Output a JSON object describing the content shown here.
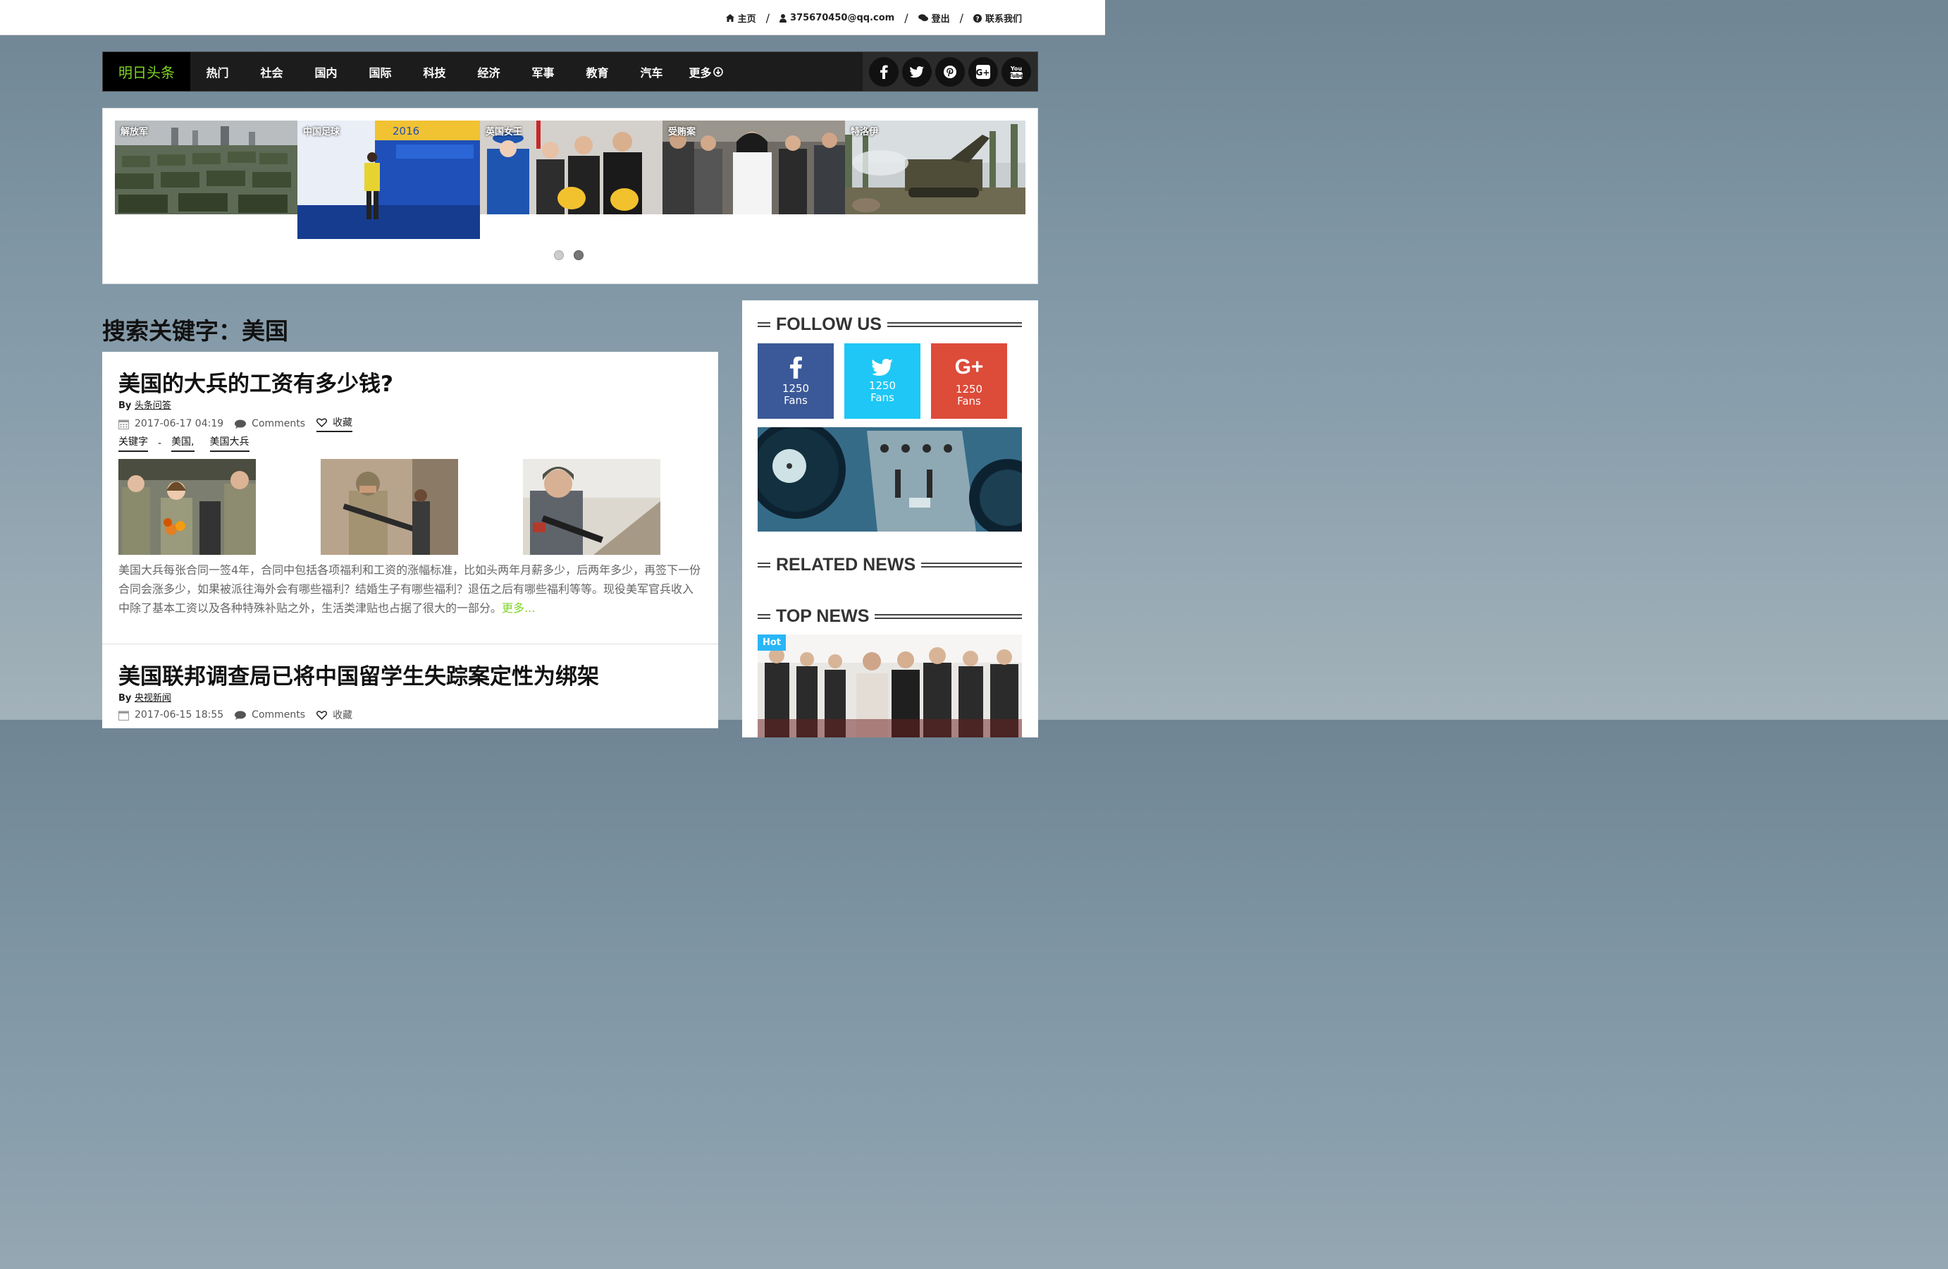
{
  "topbar": {
    "home": "主页",
    "email": "375670450@qq.com",
    "logout": "登出",
    "contact": "联系我们",
    "sep": "/"
  },
  "nav": {
    "brand": "明日头条",
    "items": [
      "热门",
      "社会",
      "国内",
      "国际",
      "科技",
      "经济",
      "军事",
      "教育",
      "汽车",
      "更多"
    ],
    "social": [
      "facebook",
      "twitter",
      "pinterest",
      "google-plus",
      "youtube"
    ],
    "youtube_label": "You Tube"
  },
  "carousel": {
    "slides": [
      {
        "label": "解放军"
      },
      {
        "label": "中国足球"
      },
      {
        "label": "英国女王"
      },
      {
        "label": "受贿案"
      },
      {
        "label": "特洛伊"
      }
    ],
    "active_dot": 2
  },
  "search": {
    "title": "搜索关键字：美国"
  },
  "articles": [
    {
      "title": "美国的大兵的工资有多少钱?",
      "by": "By",
      "author": "头条问答",
      "date": "2017-06-17 04:19",
      "comments": "Comments",
      "favorite": "收藏",
      "tags_label": "关键字",
      "tags_sep": "-",
      "tags": [
        "美国,",
        "美国大兵"
      ],
      "excerpt": "美国大兵每张合同一签4年，合同中包括各项福利和工资的涨幅标准，比如头两年月薪多少，后两年多少，再签下一份合同会涨多少，如果被派往海外会有哪些福利？结婚生子有哪些福利？退伍之后有哪些福利等等。现役美军官兵收入中除了基本工资以及各种特殊补贴之外，生活类津贴也占据了很大的一部分。",
      "more": "更多..."
    },
    {
      "title": "美国联邦调查局已将中国留学生失踪案定性为绑架",
      "by": "By",
      "author": "央视新闻",
      "date": "2017-06-15 18:55",
      "comments": "Comments",
      "favorite": "收藏"
    }
  ],
  "sidebar": {
    "follow_title": "FOLLOW US",
    "fans": [
      {
        "network": "facebook",
        "icon": "f",
        "count": "1250",
        "unit": "Fans",
        "color": "#3b5998"
      },
      {
        "network": "twitter",
        "icon": "t",
        "count": "1250",
        "unit": "Fans",
        "color": "#1ec7f5"
      },
      {
        "network": "google-plus",
        "icon": "G+",
        "count": "1250",
        "unit": "Fans",
        "color": "#dd4b39"
      }
    ],
    "related_title": "RELATED NEWS",
    "top_title": "TOP NEWS",
    "hot_badge": "Hot"
  },
  "colors": {
    "accent": "#7ed321",
    "nav_bg": "#1c1c1c",
    "hot": "#29b6f6"
  }
}
